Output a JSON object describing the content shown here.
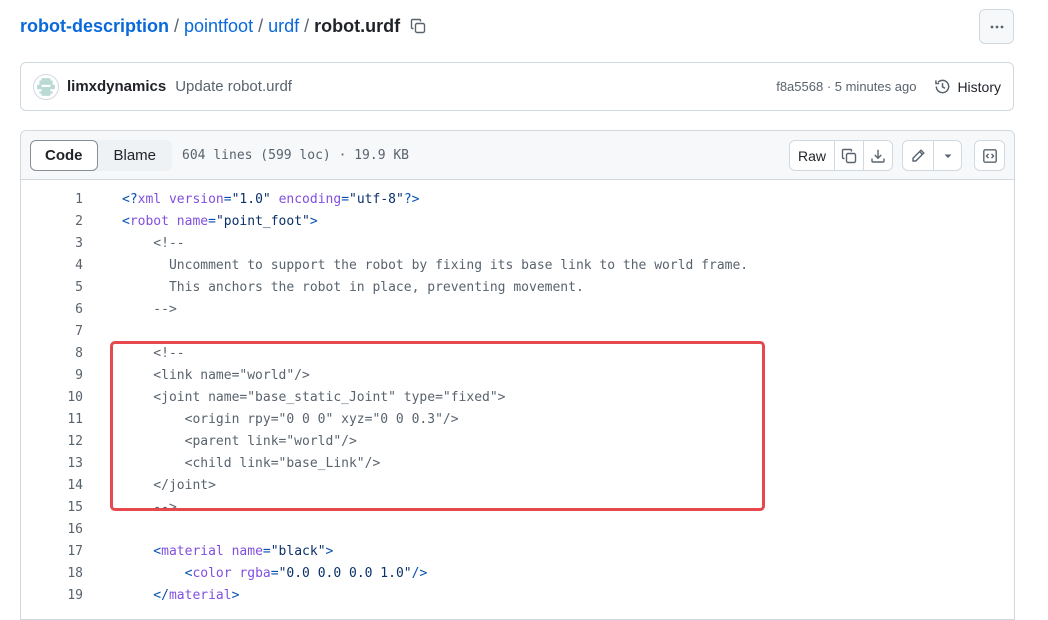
{
  "breadcrumb": {
    "repo": "robot-description",
    "sep": "/",
    "folder1": "pointfoot",
    "folder2": "urdf",
    "file": "robot.urdf"
  },
  "commit": {
    "author": "limxdynamics",
    "message": "Update robot.urdf",
    "meta": "f8a5568 · 5 minutes ago",
    "history_label": "History"
  },
  "file_header": {
    "tab_code": "Code",
    "tab_blame": "Blame",
    "info": "604 lines (599 loc) · 19.9 KB",
    "raw_label": "Raw"
  },
  "code_lines": [
    {
      "n": "1",
      "parts": [
        [
          "t",
          "<?"
        ],
        [
          "a",
          "xml "
        ],
        [
          "a",
          "version"
        ],
        [
          "t",
          "="
        ],
        [
          "s",
          "\"1.0\""
        ],
        [
          "t",
          " "
        ],
        [
          "a",
          "encoding"
        ],
        [
          "t",
          "="
        ],
        [
          "s",
          "\"utf-8\""
        ],
        [
          "t",
          "?>"
        ]
      ]
    },
    {
      "n": "2",
      "parts": [
        [
          "t",
          "<"
        ],
        [
          "a",
          "robot "
        ],
        [
          "a",
          "name"
        ],
        [
          "t",
          "="
        ],
        [
          "s",
          "\"point_foot\""
        ],
        [
          "t",
          ">"
        ]
      ]
    },
    {
      "n": "3",
      "parts": [
        [
          "c",
          "    <!--"
        ]
      ]
    },
    {
      "n": "4",
      "parts": [
        [
          "c",
          "      Uncomment to support the robot by fixing its base link to the world frame."
        ]
      ]
    },
    {
      "n": "5",
      "parts": [
        [
          "c",
          "      This anchors the robot in place, preventing movement."
        ]
      ]
    },
    {
      "n": "6",
      "parts": [
        [
          "c",
          "    -->"
        ]
      ]
    },
    {
      "n": "7",
      "parts": [
        [
          "c",
          ""
        ]
      ]
    },
    {
      "n": "8",
      "parts": [
        [
          "c",
          "    <!--"
        ]
      ]
    },
    {
      "n": "9",
      "parts": [
        [
          "c",
          "    <link name=\"world\"/>"
        ]
      ]
    },
    {
      "n": "10",
      "parts": [
        [
          "c",
          "    <joint name=\"base_static_Joint\" type=\"fixed\">"
        ]
      ]
    },
    {
      "n": "11",
      "parts": [
        [
          "c",
          "        <origin rpy=\"0 0 0\" xyz=\"0 0 0.3\"/>"
        ]
      ]
    },
    {
      "n": "12",
      "parts": [
        [
          "c",
          "        <parent link=\"world\"/>"
        ]
      ]
    },
    {
      "n": "13",
      "parts": [
        [
          "c",
          "        <child link=\"base_Link\"/>"
        ]
      ]
    },
    {
      "n": "14",
      "parts": [
        [
          "c",
          "    </joint>"
        ]
      ]
    },
    {
      "n": "15",
      "parts": [
        [
          "c",
          "    -->"
        ]
      ]
    },
    {
      "n": "16",
      "parts": [
        [
          "c",
          ""
        ]
      ]
    },
    {
      "n": "17",
      "parts": [
        [
          "t",
          "    <"
        ],
        [
          "a",
          "material "
        ],
        [
          "a",
          "name"
        ],
        [
          "t",
          "="
        ],
        [
          "s",
          "\"black\""
        ],
        [
          "t",
          ">"
        ]
      ]
    },
    {
      "n": "18",
      "parts": [
        [
          "t",
          "        <"
        ],
        [
          "a",
          "color "
        ],
        [
          "a",
          "rgba"
        ],
        [
          "t",
          "="
        ],
        [
          "s",
          "\"0.0 0.0 0.0 1.0\""
        ],
        [
          "t",
          "/>"
        ]
      ]
    },
    {
      "n": "19",
      "parts": [
        [
          "t",
          "    </"
        ],
        [
          "a",
          "material"
        ],
        [
          "t",
          ">"
        ]
      ]
    }
  ],
  "colors": {
    "link": "#0969da",
    "highlight": "#e5484d",
    "comment": "#59636e",
    "attr": "#8250df",
    "string": "#0a3069"
  }
}
